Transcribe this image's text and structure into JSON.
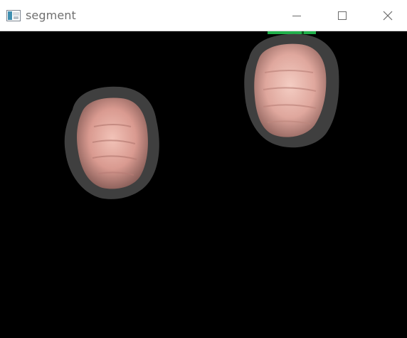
{
  "window": {
    "title": "segment",
    "controls": {
      "minimize": "minimize-icon",
      "maximize": "maximize-icon",
      "close": "close-icon"
    }
  },
  "canvas": {
    "background": "#000000",
    "indicator_color": "#22b14c",
    "objects": [
      "left-fist",
      "right-fist"
    ]
  }
}
